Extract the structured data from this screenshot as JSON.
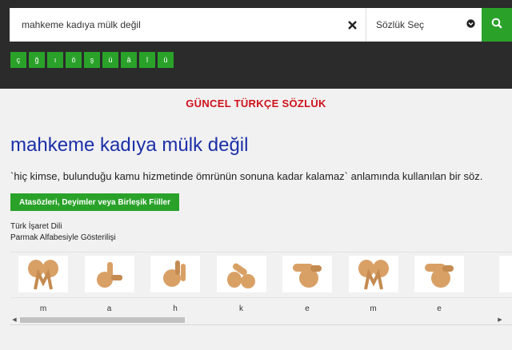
{
  "search": {
    "value": "mahkeme kadıya mülk değil",
    "clear_icon": "close-icon",
    "dictionary_select": "Sözlük Seç",
    "select_icon": "chevron-down-circle-icon",
    "search_icon": "search-icon"
  },
  "special_chars": [
    "ç",
    "ğ",
    "ı",
    "ö",
    "ş",
    "ü",
    "â",
    "î",
    "û"
  ],
  "dictionary_title": "GÜNCEL TÜRKÇE SÖZLÜK",
  "entry": {
    "word": "mahkeme kadıya mülk değil",
    "definition": "`hiç kimse, bulunduğu kamu hizmetinde ömrünün sonuna kadar kalamaz` anlamında kullanılan bir söz.",
    "category_button": "Atasözleri, Deyimler veya Birleşik Fiiller"
  },
  "sign_language": {
    "line1": "Türk İşaret Dili",
    "line2": "Parmak Alfabesiyle Gösterilişi",
    "letters": [
      "m",
      "a",
      "h",
      "k",
      "e",
      "m",
      "e"
    ],
    "scroll_left_icon": "triangle-left-icon",
    "scroll_right_icon": "triangle-right-icon",
    "scroll_position": 0
  },
  "colors": {
    "green": "#2aa22a",
    "title_red": "#d0101a",
    "word_blue": "#1b2fa8",
    "topbar": "#2b2b2b",
    "skin": "#d9a066"
  }
}
